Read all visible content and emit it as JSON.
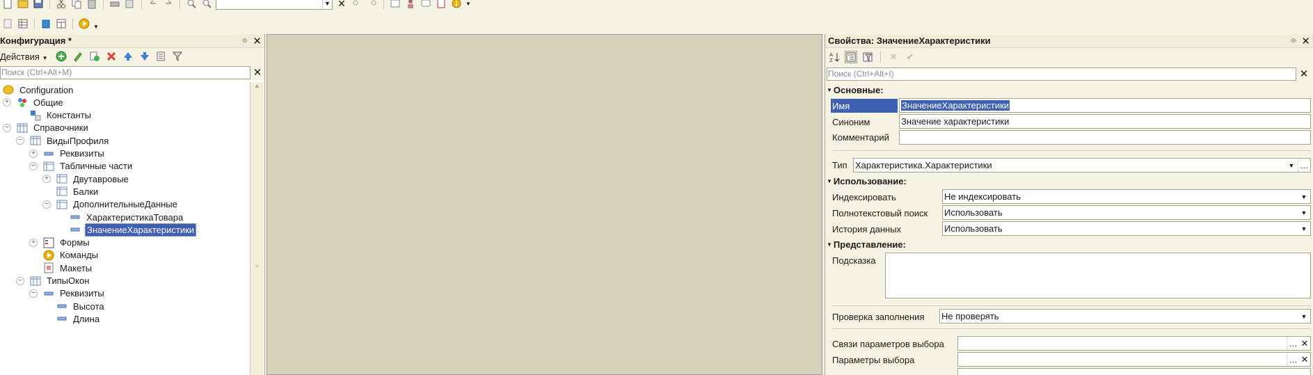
{
  "toolbar": {
    "search_value": "",
    "icons1": [
      "new-file-icon",
      "open-folder-icon",
      "save-icon",
      "cut-icon",
      "copy-icon",
      "paste-icon",
      "print-icon",
      "print-preview-icon",
      "undo-icon",
      "redo-icon",
      "find-icon",
      "find-next-icon"
    ],
    "icons2": [
      "list-icon",
      "grid-icon",
      "database-update-icon",
      "table-icon",
      "run-icon"
    ]
  },
  "left_panel": {
    "title": "Конфигурация *",
    "actions_label": "Действия",
    "search_placeholder": "Поиск (Ctrl+Alt+M)",
    "tree": [
      {
        "label": "Configuration",
        "level": 0,
        "expander": "none",
        "icon": "config-icon"
      },
      {
        "label": "Общие",
        "level": 0,
        "expander": "plus",
        "icon": "common-icon"
      },
      {
        "label": "Константы",
        "level": 1,
        "expander": "none",
        "icon": "constants-icon"
      },
      {
        "label": "Справочники",
        "level": 0,
        "expander": "minus",
        "icon": "catalog-icon"
      },
      {
        "label": "ВидыПрофиля",
        "level": 1,
        "expander": "minus",
        "icon": "catalog-icon"
      },
      {
        "label": "Реквизиты",
        "level": 2,
        "expander": "plus",
        "icon": "attribute-icon"
      },
      {
        "label": "Табличные части",
        "level": 2,
        "expander": "minus",
        "icon": "table-part-icon"
      },
      {
        "label": "Двутавровые",
        "level": 3,
        "expander": "plus",
        "icon": "table-part-icon"
      },
      {
        "label": "Балки",
        "level": 3,
        "expander": "none",
        "icon": "table-part-icon"
      },
      {
        "label": "ДополнительныеДанные",
        "level": 3,
        "expander": "minus",
        "icon": "table-part-icon"
      },
      {
        "label": "ХарактеристикаТовара",
        "level": 4,
        "expander": "none",
        "icon": "attribute-icon"
      },
      {
        "label": "ЗначениеХарактеристики",
        "level": 4,
        "expander": "none",
        "icon": "attribute-icon",
        "selected": true
      },
      {
        "label": "Формы",
        "level": 2,
        "expander": "plus",
        "icon": "forms-icon"
      },
      {
        "label": "Команды",
        "level": 2,
        "expander": "none",
        "icon": "commands-icon"
      },
      {
        "label": "Макеты",
        "level": 2,
        "expander": "none",
        "icon": "templates-icon"
      },
      {
        "label": "ТипыОкон",
        "level": 1,
        "expander": "minus",
        "icon": "catalog-icon"
      },
      {
        "label": "Реквизиты",
        "level": 2,
        "expander": "minus",
        "icon": "attribute-icon"
      },
      {
        "label": "Высота",
        "level": 3,
        "expander": "none",
        "icon": "attribute-icon"
      },
      {
        "label": "Длина",
        "level": 3,
        "expander": "none",
        "icon": "attribute-icon"
      }
    ]
  },
  "right_panel": {
    "title": "Свойства: ЗначениеХарактеристики",
    "search_placeholder": "Поиск (Ctrl+Alt+I)",
    "sections": {
      "main": "Основные:",
      "usage": "Использование:",
      "presentation": "Представление:"
    },
    "props": {
      "name_label": "Имя",
      "name_value": "ЗначениеХарактеристики",
      "synonym_label": "Синоним",
      "synonym_value": "Значение характеристики",
      "comment_label": "Комментарий",
      "comment_value": "",
      "type_label": "Тип",
      "type_value": "Характеристика.Характеристики",
      "indexing_label": "Индексировать",
      "indexing_value": "Не индексировать",
      "fulltext_label": "Полнотекстовый поиск",
      "fulltext_value": "Использовать",
      "history_label": "История данных",
      "history_value": "Использовать",
      "tooltip_label": "Подсказка",
      "tooltip_value": "",
      "fill_check_label": "Проверка заполнения",
      "fill_check_value": "Не проверять",
      "choice_links_label": "Связи параметров выбора",
      "choice_links_value": "",
      "choice_params_label": "Параметры выбора",
      "choice_params_value": ""
    }
  }
}
